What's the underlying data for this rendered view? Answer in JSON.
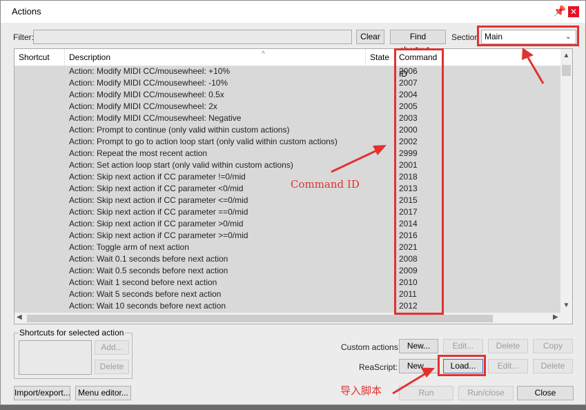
{
  "window": {
    "title": "Actions"
  },
  "toolbar": {
    "filter_label": "Filter:",
    "filter_value": "",
    "clear_label": "Clear",
    "find_shortcut_label": "Find shortcut...",
    "section_label": "Section",
    "section_value": "Main"
  },
  "table": {
    "columns": [
      "Shortcut",
      "Description",
      "State",
      "Command ID"
    ],
    "rows": [
      {
        "shortcut": "",
        "description": "Action: Modify MIDI CC/mousewheel: +10%",
        "state": "",
        "command_id": "2006"
      },
      {
        "shortcut": "",
        "description": "Action: Modify MIDI CC/mousewheel: -10%",
        "state": "",
        "command_id": "2007"
      },
      {
        "shortcut": "",
        "description": "Action: Modify MIDI CC/mousewheel: 0.5x",
        "state": "",
        "command_id": "2004"
      },
      {
        "shortcut": "",
        "description": "Action: Modify MIDI CC/mousewheel: 2x",
        "state": "",
        "command_id": "2005"
      },
      {
        "shortcut": "",
        "description": "Action: Modify MIDI CC/mousewheel: Negative",
        "state": "",
        "command_id": "2003"
      },
      {
        "shortcut": "",
        "description": "Action: Prompt to continue (only valid within custom actions)",
        "state": "",
        "command_id": "2000"
      },
      {
        "shortcut": "",
        "description": "Action: Prompt to go to action loop start (only valid within custom actions)",
        "state": "",
        "command_id": "2002"
      },
      {
        "shortcut": "",
        "description": "Action: Repeat the most recent action",
        "state": "",
        "command_id": "2999"
      },
      {
        "shortcut": "",
        "description": "Action: Set action loop start (only valid within custom actions)",
        "state": "",
        "command_id": "2001"
      },
      {
        "shortcut": "",
        "description": "Action: Skip next action if CC parameter !=0/mid",
        "state": "",
        "command_id": "2018"
      },
      {
        "shortcut": "",
        "description": "Action: Skip next action if CC parameter <0/mid",
        "state": "",
        "command_id": "2013"
      },
      {
        "shortcut": "",
        "description": "Action: Skip next action if CC parameter <=0/mid",
        "state": "",
        "command_id": "2015"
      },
      {
        "shortcut": "",
        "description": "Action: Skip next action if CC parameter ==0/mid",
        "state": "",
        "command_id": "2017"
      },
      {
        "shortcut": "",
        "description": "Action: Skip next action if CC parameter >0/mid",
        "state": "",
        "command_id": "2014"
      },
      {
        "shortcut": "",
        "description": "Action: Skip next action if CC parameter >=0/mid",
        "state": "",
        "command_id": "2016"
      },
      {
        "shortcut": "",
        "description": "Action: Toggle arm of next action",
        "state": "",
        "command_id": "2021"
      },
      {
        "shortcut": "",
        "description": "Action: Wait 0.1 seconds before next action",
        "state": "",
        "command_id": "2008"
      },
      {
        "shortcut": "",
        "description": "Action: Wait 0.5 seconds before next action",
        "state": "",
        "command_id": "2009"
      },
      {
        "shortcut": "",
        "description": "Action: Wait 1 second before next action",
        "state": "",
        "command_id": "2010"
      },
      {
        "shortcut": "",
        "description": "Action: Wait 5 seconds before next action",
        "state": "",
        "command_id": "2011"
      },
      {
        "shortcut": "",
        "description": "Action: Wait 10 seconds before next action",
        "state": "",
        "command_id": "2012"
      }
    ]
  },
  "shortcuts_group": {
    "title": "Shortcuts for selected action",
    "add_label": "Add...",
    "delete_label": "Delete"
  },
  "custom_actions": {
    "label": "Custom actions:",
    "new_label": "New...",
    "edit_label": "Edit...",
    "delete_label": "Delete",
    "copy_label": "Copy"
  },
  "reascript": {
    "label": "ReaScript:",
    "new_label": "New...",
    "load_label": "Load...",
    "edit_label": "Edit...",
    "delete_label": "Delete"
  },
  "footer": {
    "import_export_label": "Import/export...",
    "menu_editor_label": "Menu editor...",
    "run_label": "Run",
    "run_close_label": "Run/close",
    "close_label": "Close"
  },
  "annotations": {
    "command_id_text": "Command ID",
    "load_script_text": "导入脚本",
    "color": "#e0322f"
  }
}
